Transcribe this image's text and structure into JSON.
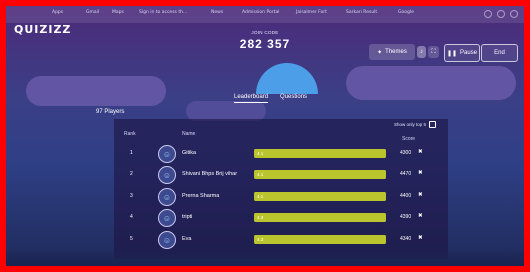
{
  "browser": {
    "bookmarks": [
      "Apps",
      "Gmail",
      "Maps",
      "Sign in to access th…",
      "News",
      "Admission Portal",
      "Jaisalmer Fort",
      "Sarkari Result",
      "Google"
    ]
  },
  "app": {
    "logo": "QUIZIZZ",
    "join_label": "JOIN CODE",
    "join_code": "282 357",
    "themes_label": "Themes",
    "pause_label": "Pause",
    "end_label": "End",
    "icons": {
      "music": "music-icon",
      "fullscreen": "fullscreen-icon",
      "themes": "palette-icon"
    }
  },
  "tabs": [
    {
      "label": "Leaderboard",
      "active": true
    },
    {
      "label": "Questions",
      "active": false
    }
  ],
  "leaderboard": {
    "player_count": "97 Players",
    "show_only_label": "Show only top 5",
    "headers": {
      "rank": "Rank",
      "name": "Name",
      "score": "Score"
    },
    "rows": [
      {
        "rank": "1",
        "name": "Gitika",
        "bar_label": "4.1",
        "score": "4300",
        "progress": 1.0
      },
      {
        "rank": "2",
        "name": "Shivani Bhps Brij vihar",
        "bar_label": "4.1",
        "score": "4470",
        "progress": 1.0
      },
      {
        "rank": "3",
        "name": "Prerna Sharma",
        "bar_label": "4.1",
        "score": "4400",
        "progress": 1.0
      },
      {
        "rank": "4",
        "name": "tripti",
        "bar_label": "4.3",
        "score": "4390",
        "progress": 1.0
      },
      {
        "rank": "5",
        "name": "Eva",
        "bar_label": "4.3",
        "score": "4340",
        "progress": 1.0
      }
    ]
  },
  "colors": {
    "bar": "#c8d23a",
    "frame": "#ff0000"
  }
}
